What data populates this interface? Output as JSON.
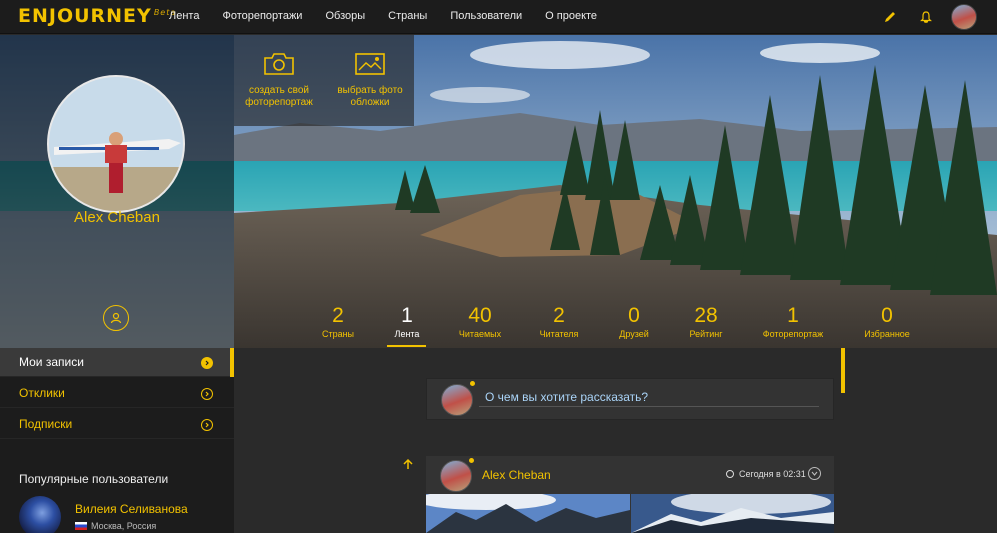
{
  "app": {
    "logo": "ENJOURNEY",
    "beta": "Beta"
  },
  "nav": {
    "items": [
      "Лента",
      "Фоторепортажи",
      "Обзоры",
      "Страны",
      "Пользователи",
      "О проекте"
    ]
  },
  "top_icons": {
    "edit": "pencil-icon",
    "notifications": "bell-icon",
    "user": "avatar"
  },
  "profile": {
    "name": "Alex Cheban",
    "profile_button_icon": "user-icon"
  },
  "cta": {
    "create_report": "создать свой фоторепортаж",
    "choose_cover": "выбрать фото обложки"
  },
  "stats": [
    {
      "value": "2",
      "label": "Страны",
      "active": false
    },
    {
      "value": "1",
      "label": "Лента",
      "active": true
    },
    {
      "value": "40",
      "label": "Читаемых",
      "active": false
    },
    {
      "value": "2",
      "label": "Читателя",
      "active": false
    },
    {
      "value": "0",
      "label": "Друзей",
      "active": false
    },
    {
      "value": "28",
      "label": "Рейтинг",
      "active": false
    },
    {
      "value": "1",
      "label": "Фоторепортаж",
      "active": false
    },
    {
      "value": "0",
      "label": "Избранное",
      "active": false
    }
  ],
  "sidebar": {
    "items": [
      {
        "label": "Мои записи",
        "active": true
      },
      {
        "label": "Отклики",
        "active": false
      },
      {
        "label": "Подписки",
        "active": false
      }
    ],
    "popular_title": "Популярные пользователи",
    "popular_users": [
      {
        "name": "Вилеия Селиванова",
        "location": "Москва, Россия"
      }
    ]
  },
  "compose": {
    "placeholder": "О чем вы хотите рассказать?"
  },
  "post": {
    "author": "Alex Cheban",
    "time": "Сегодня в 02:31"
  },
  "colors": {
    "accent": "#f2c200",
    "topbar": "#1c1c1c",
    "sidebar": "#1c1c1c",
    "feed": "#2a2a2a",
    "link": "#aad4f8"
  }
}
